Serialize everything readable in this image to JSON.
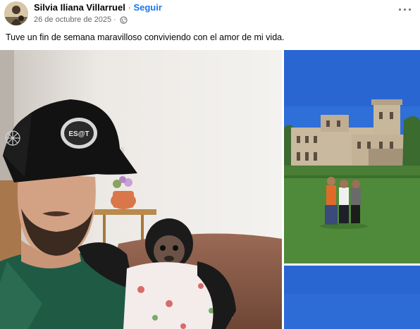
{
  "post": {
    "author": "Silvia Iliana Villarruel",
    "separator": "·",
    "follow_label": "Seguir",
    "date": "26 de octubre de 2025",
    "date_separator": "·",
    "more_label": "···",
    "caption": "Tuve un fin de semana maravilloso conviviendo con el amor de mi vida.",
    "cap_logo_text": "ES@T",
    "icons": {
      "privacy": "globe-icon",
      "more": "more-options-icon"
    },
    "colors": {
      "link": "#1877f2",
      "secondary_text": "#65676b",
      "sky": "#2f6fd8"
    }
  }
}
